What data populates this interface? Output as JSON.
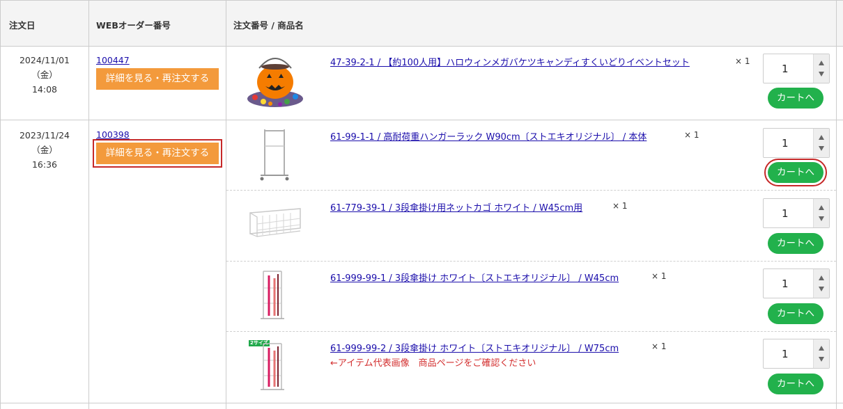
{
  "headers": {
    "order_date": "注文日",
    "web_order_no": "WEBオーダー番号",
    "order_no_product": "注文番号 / 商品名"
  },
  "orders": [
    {
      "date": "2024/11/01",
      "weekday": "（金）",
      "time": "14:08",
      "web_order_no": "100447",
      "detail_button": "詳細を見る・再注文する",
      "items": [
        {
          "name": "47-39-2-1 / 【約100人用】ハロウィンメガバケツキャンディすくいどりイベントセット",
          "qty_mark": "× 1",
          "qty": "1",
          "cart_button": "カートへ"
        }
      ]
    },
    {
      "date": "2023/11/24",
      "weekday": "（金）",
      "time": "16:36",
      "web_order_no": "100398",
      "detail_button": "詳細を見る・再注文する",
      "items": [
        {
          "name": "61-99-1-1 / 高耐荷重ハンガーラック W90cm〔ストエキオリジナル〕 / 本体",
          "qty_mark": "× 1",
          "qty": "1",
          "cart_button": "カートへ"
        },
        {
          "name": "61-779-39-1 / 3段傘掛け用ネットカゴ ホワイト / W45cm用",
          "qty_mark": "× 1",
          "qty": "1",
          "cart_button": "カートへ"
        },
        {
          "name": "61-999-99-1 / 3段傘掛け ホワイト〔ストエキオリジナル〕 / W45cm",
          "qty_mark": "× 1",
          "qty": "1",
          "cart_button": "カートへ"
        },
        {
          "name": "61-999-99-2 / 3段傘掛け ホワイト〔ストエキオリジナル〕 / W75cm",
          "qty_mark": "× 1",
          "qty": "1",
          "cart_button": "カートへ",
          "note": "←アイテム代表画像　商品ページをご確認ください",
          "badge": "2サイズ"
        }
      ]
    }
  ],
  "colors": {
    "detail_button": "#f39a3c",
    "cart_button": "#22b14c",
    "link": "#1a0dab",
    "highlight_outline": "#c62828",
    "note": "#d32f2f"
  },
  "icons": {
    "spinner_up": "triangle-up-icon",
    "spinner_down": "triangle-down-icon"
  }
}
